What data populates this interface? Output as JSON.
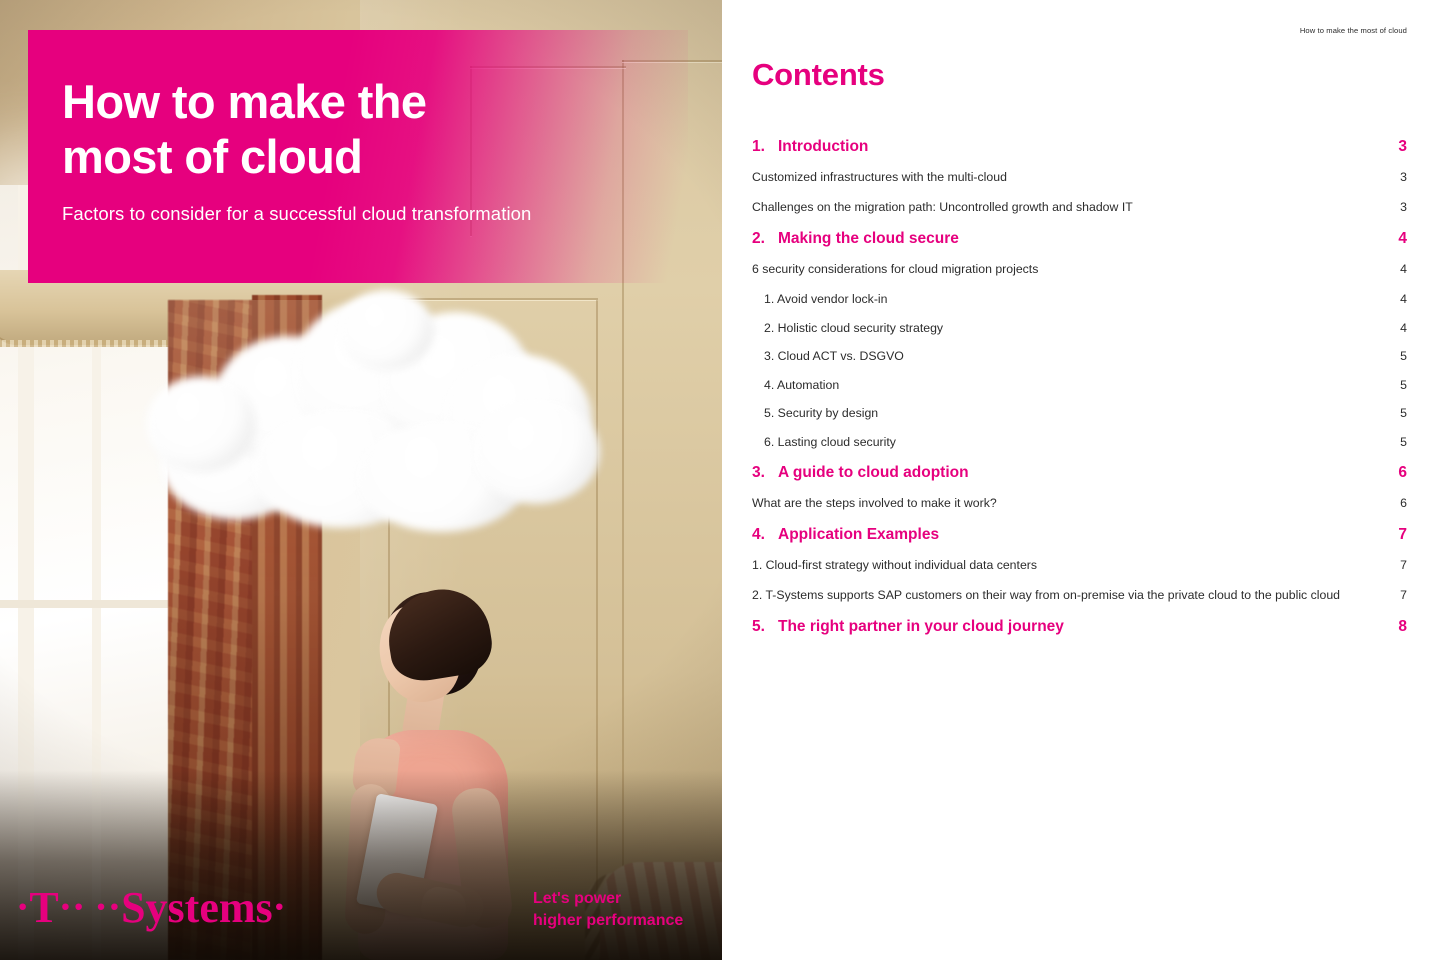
{
  "cover": {
    "title": "How to make the\nmost of cloud",
    "subtitle": "Factors to consider for a successful cloud transformation",
    "logo_text": "T Systems",
    "claim": "Let's power\nhigher performance",
    "brand_color": "#e6007e",
    "image_description": "Woman in pink dress holding a tablet looking up at a white cloud floating in an ornate room"
  },
  "contents": {
    "running_header": "How to make the most of cloud",
    "title": "Contents",
    "entries": [
      {
        "level": "section",
        "number": "1.",
        "label": "Introduction",
        "page": "3"
      },
      {
        "level": "sub",
        "number": "",
        "label": "Customized infrastructures with the multi-cloud",
        "page": "3"
      },
      {
        "level": "sub",
        "number": "",
        "label": "Challenges on the migration path: Uncontrolled growth and shadow IT",
        "page": "3"
      },
      {
        "level": "section",
        "number": "2.",
        "label": "Making the cloud secure",
        "page": "4"
      },
      {
        "level": "sub",
        "number": "",
        "label": "6 security considerations for cloud migration projects",
        "page": "4"
      },
      {
        "level": "subsub",
        "number": "",
        "label": "1. Avoid vendor lock-in",
        "page": "4"
      },
      {
        "level": "subsub",
        "number": "",
        "label": "2. Holistic cloud security strategy",
        "page": "4"
      },
      {
        "level": "subsub",
        "number": "",
        "label": "3. Cloud ACT vs. DSGVO",
        "page": "5"
      },
      {
        "level": "subsub",
        "number": "",
        "label": "4. Automation",
        "page": "5"
      },
      {
        "level": "subsub",
        "number": "",
        "label": "5. Security by design",
        "page": "5"
      },
      {
        "level": "subsub",
        "number": "",
        "label": "6. Lasting cloud security",
        "page": "5"
      },
      {
        "level": "section",
        "number": "3.",
        "label": "A guide to cloud adoption",
        "page": "6"
      },
      {
        "level": "sub",
        "number": "",
        "label": "What are the steps involved to make it work?",
        "page": "6"
      },
      {
        "level": "section",
        "number": "4.",
        "label": "Application Examples",
        "page": "7"
      },
      {
        "level": "sub",
        "number": "",
        "label": "1. Cloud-first strategy without individual data centers",
        "page": "7"
      },
      {
        "level": "sub",
        "number": "",
        "label": "2. T-Systems supports SAP customers on their way from on-premise via the private cloud to the public cloud",
        "page": "7"
      },
      {
        "level": "section",
        "number": "5.",
        "label": "The right partner in your cloud journey",
        "page": "8"
      }
    ]
  }
}
